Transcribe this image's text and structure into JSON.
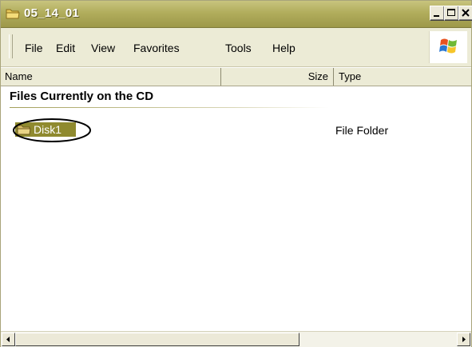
{
  "window": {
    "title": "05_14_01"
  },
  "title_buttons": {
    "minimize": "minimize-icon",
    "maximize": "maximize-icon",
    "close": "close-icon"
  },
  "menu": {
    "items": [
      "File",
      "Edit",
      "View",
      "Favorites",
      "Tools",
      "Help"
    ]
  },
  "columns": {
    "name": "Name",
    "size": "Size",
    "type": "Type"
  },
  "group": {
    "heading": "Files Currently on the CD"
  },
  "files": [
    {
      "name": "Disk1",
      "size": "",
      "type": "File Folder",
      "selected": true,
      "annotated": true
    }
  ],
  "colors": {
    "titlebar": "#b1ad5c",
    "selection": "#8f8a2f",
    "menubar": "#ecebd6"
  },
  "scrollbar": {
    "horizontal_position_fraction": 0.0
  }
}
